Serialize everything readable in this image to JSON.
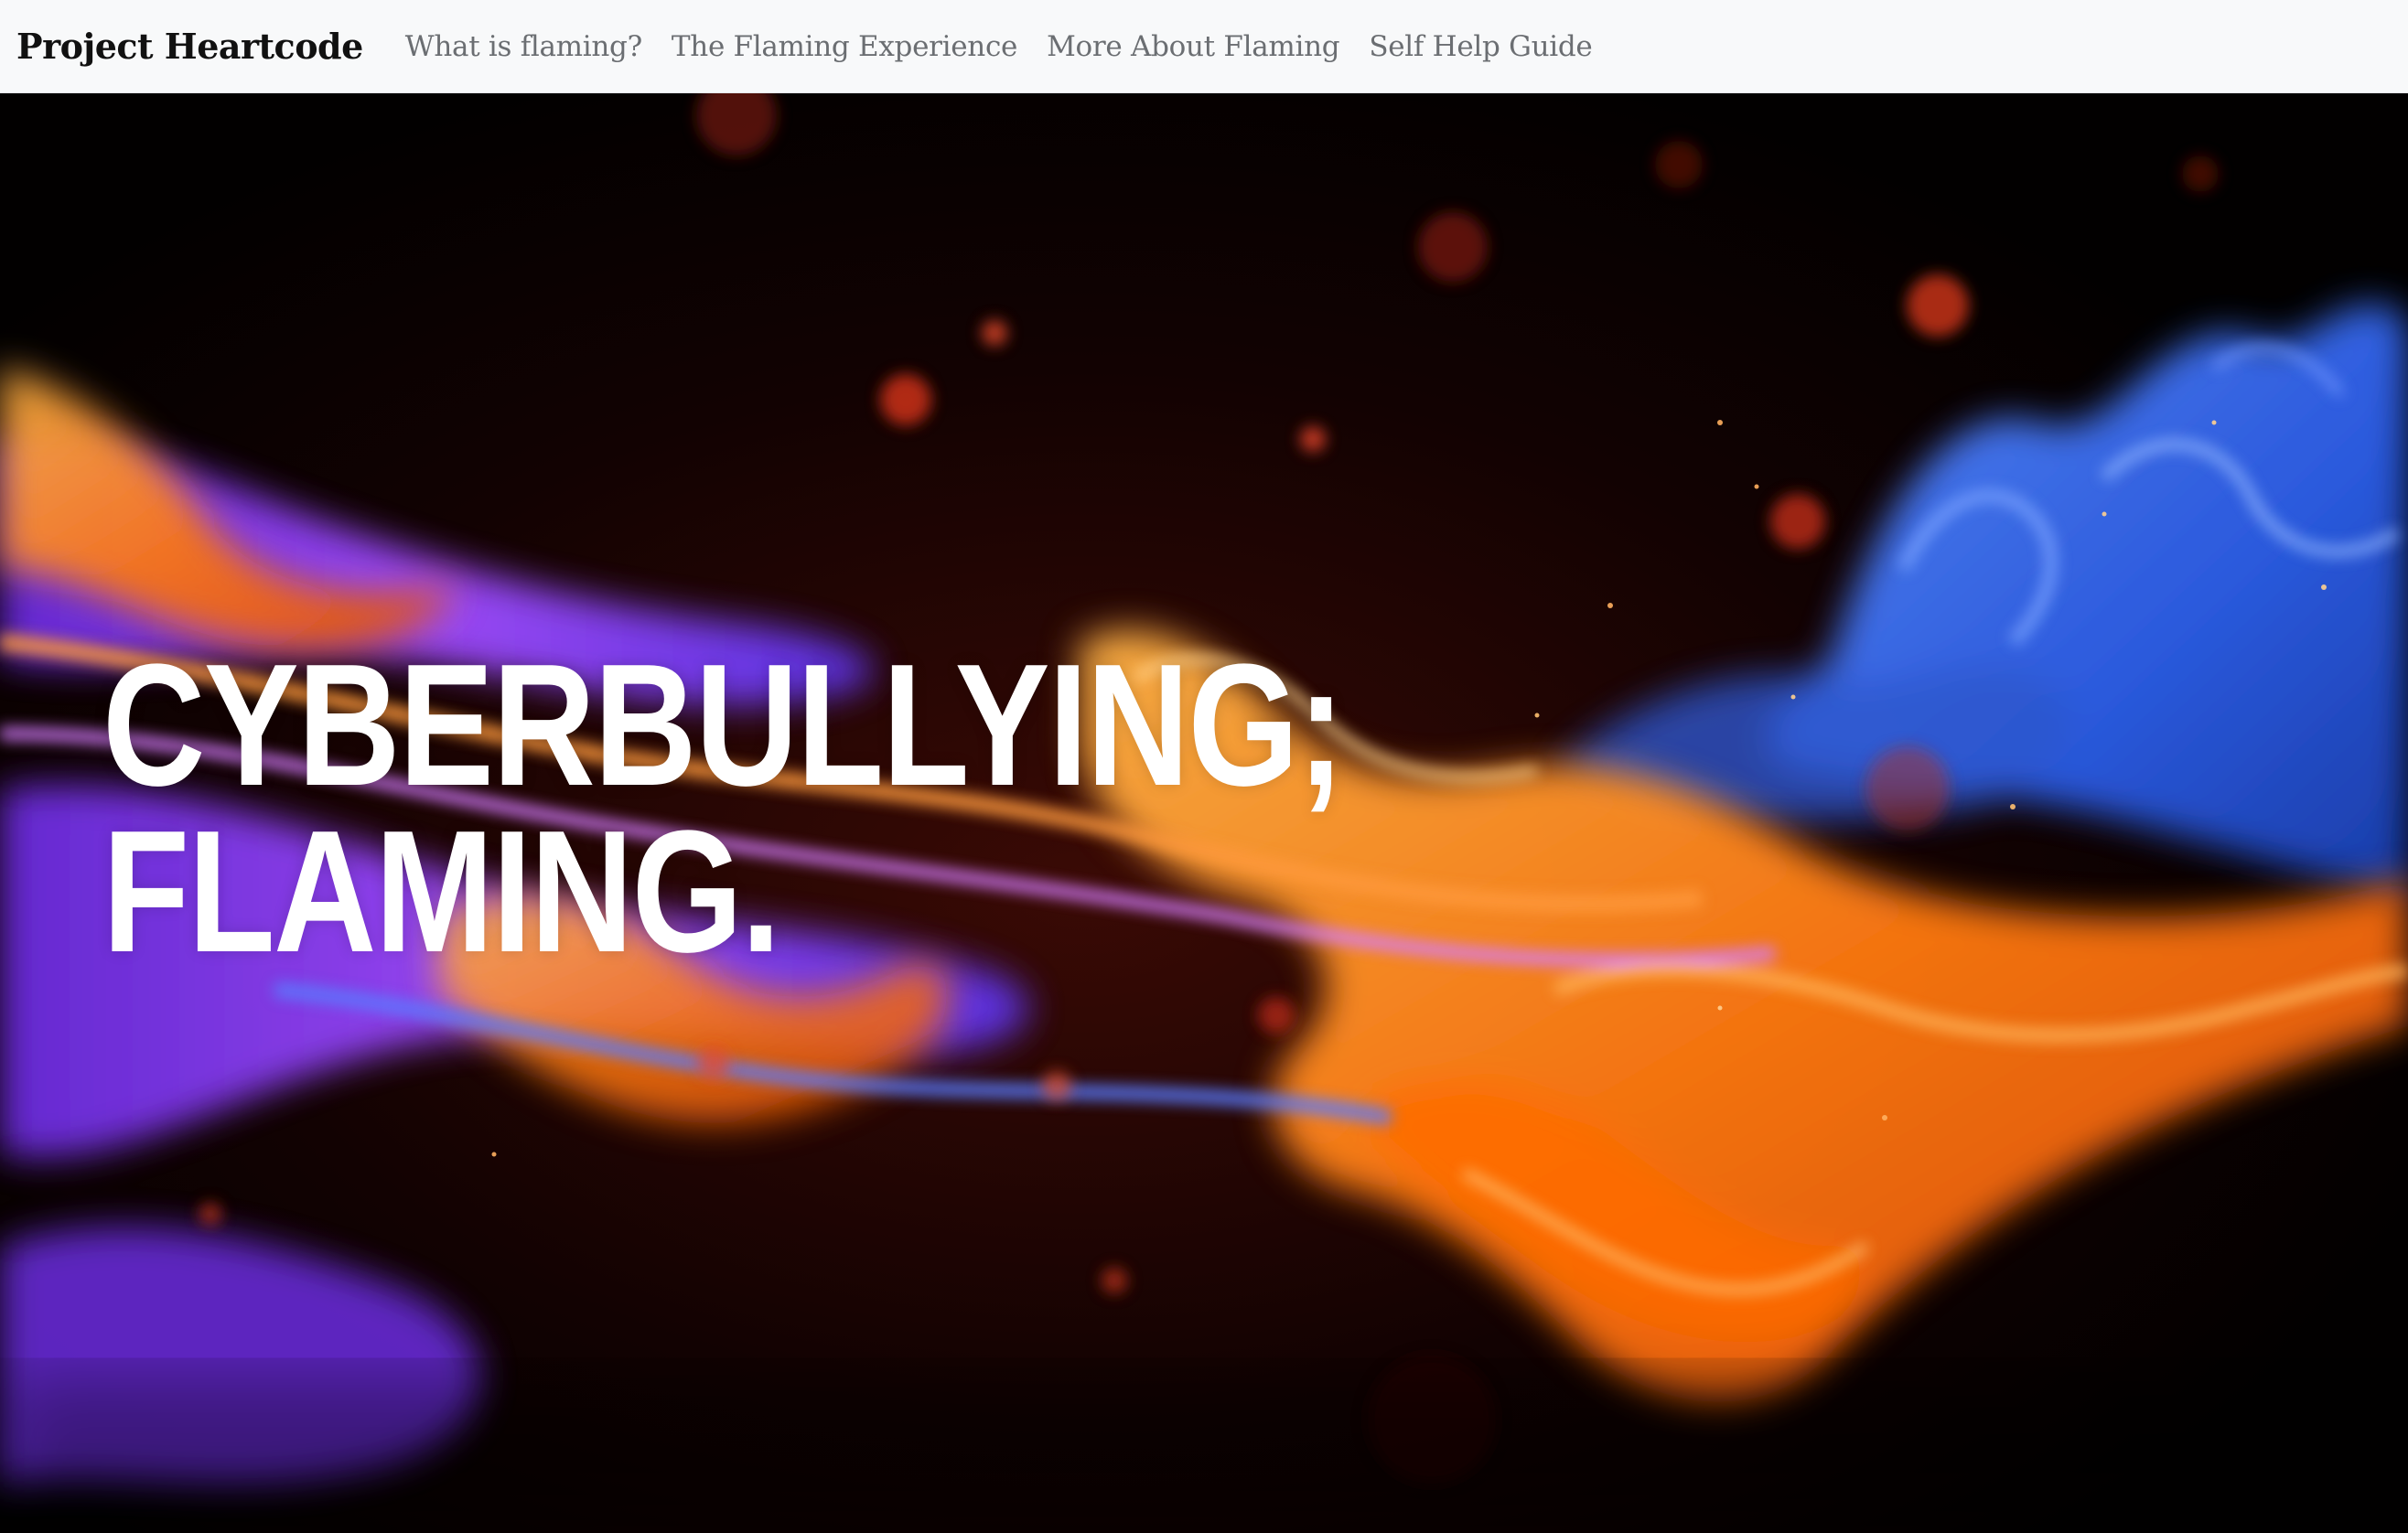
{
  "navbar": {
    "brand": "Project Heartcode",
    "links": [
      {
        "label": "What is flaming?"
      },
      {
        "label": "The Flaming Experience"
      },
      {
        "label": "More About Flaming"
      },
      {
        "label": "Self Help Guide"
      }
    ]
  },
  "hero": {
    "headline_line1": "CYBERBULLYING;",
    "headline_line2": "FLAMING.",
    "background_image": "flame-smoke-image",
    "colors": {
      "orange": "#ff8a1c",
      "purple": "#8a3cff",
      "blue": "#2f6bff",
      "background": "#000000",
      "text": "#ffffff"
    }
  }
}
